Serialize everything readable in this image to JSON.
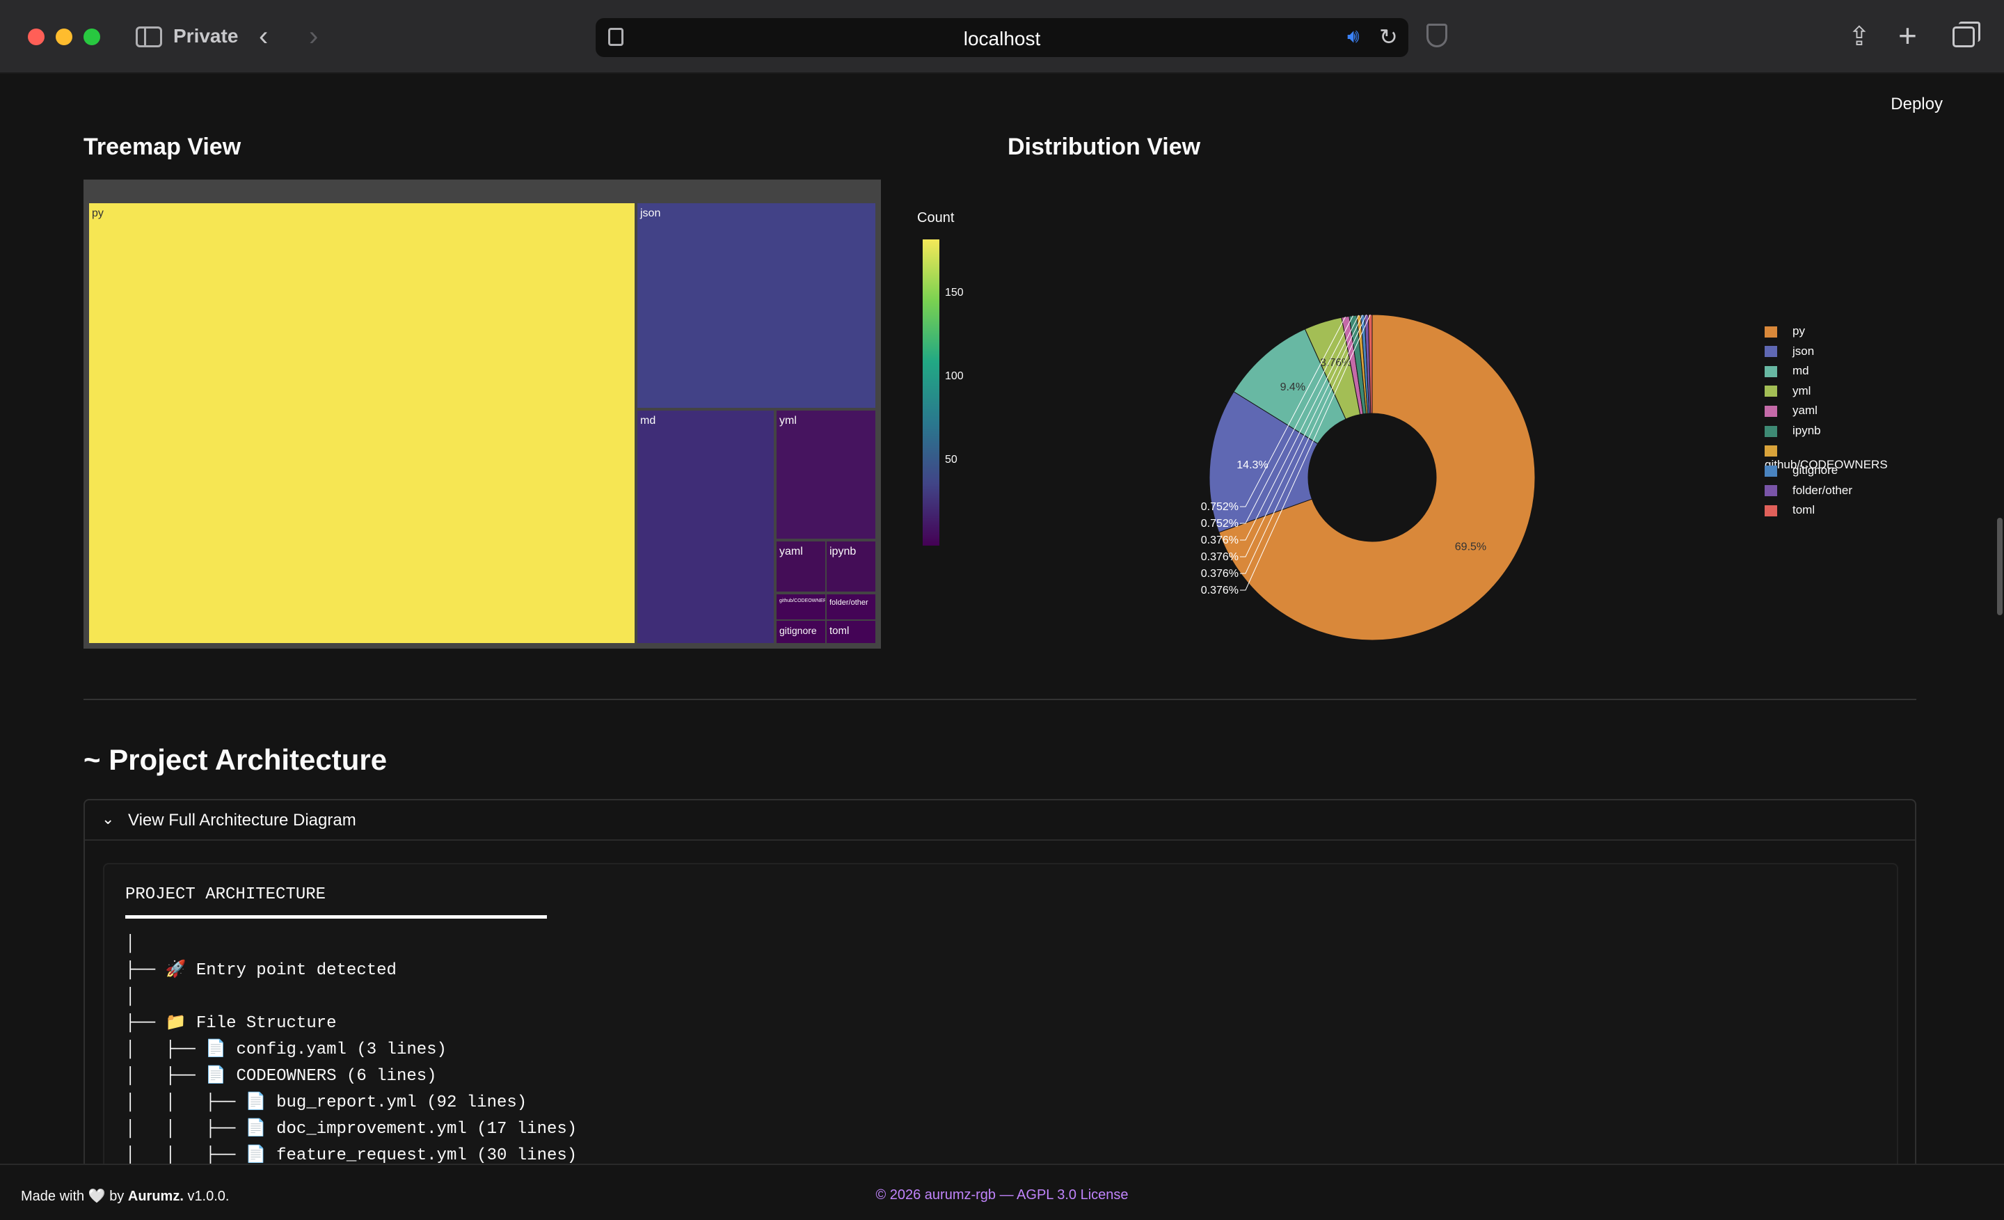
{
  "browser": {
    "window_label": "Private",
    "url": "localhost",
    "icons": [
      "sidebar-icon",
      "back-icon",
      "forward-icon",
      "page-icon",
      "sound-icon",
      "reload-icon",
      "shield-icon",
      "share-icon",
      "new-tab-icon",
      "tabs-icon"
    ]
  },
  "app": {
    "deploy_label": "Deploy",
    "treemap_title": "Treemap View",
    "distribution_title": "Distribution View",
    "architecture_title": "~ Project Architecture",
    "expander_label": "View Full Architecture Diagram"
  },
  "chart_data": [
    {
      "type": "treemap",
      "colorbar_title": "Count",
      "colorbar_ticks": [
        "150",
        "100",
        "50"
      ],
      "colorscale": [
        "#440154",
        "#414487",
        "#2a788e",
        "#22a884",
        "#7ad151",
        "#f4e859"
      ],
      "cells": [
        {
          "label": "py",
          "value": 185,
          "color": "#f6e653"
        },
        {
          "label": "json",
          "value": 38,
          "color": "#424287"
        },
        {
          "label": "md",
          "value": 25,
          "color": "#3f2d77"
        },
        {
          "label": "yml",
          "value": 10,
          "color": "#46145f"
        },
        {
          "label": "yaml",
          "value": 2,
          "color": "#440d57"
        },
        {
          "label": "ipynb",
          "value": 2,
          "color": "#440d57"
        },
        {
          "label": "github/CODEOWNERS",
          "value": 1,
          "color": "#440456"
        },
        {
          "label": "folder/other",
          "value": 1,
          "color": "#440456"
        },
        {
          "label": "gitignore",
          "value": 1,
          "color": "#440456"
        },
        {
          "label": "toml",
          "value": 1,
          "color": "#440456"
        }
      ]
    },
    {
      "type": "pie",
      "hole": true,
      "legend_position": "right",
      "slices": [
        {
          "label": "py",
          "percent": 69.5,
          "text": "69.5%",
          "color": "#d9883a"
        },
        {
          "label": "json",
          "percent": 14.3,
          "text": "14.3%",
          "color": "#5f68b3"
        },
        {
          "label": "md",
          "percent": 9.4,
          "text": "9.4%",
          "color": "#68b8a3"
        },
        {
          "label": "yml",
          "percent": 3.76,
          "text": "3.76%",
          "color": "#a3be55"
        },
        {
          "label": "yaml",
          "percent": 0.752,
          "text": "0.752%",
          "color": "#c46aa8"
        },
        {
          "label": "ipynb",
          "percent": 0.752,
          "text": "0.752%",
          "color": "#3e8a74"
        },
        {
          "label": "github/CODEOWNERS",
          "percent": 0.376,
          "text": "0.376%",
          "color": "#d9a33a"
        },
        {
          "label": "gitignore",
          "percent": 0.376,
          "text": "0.376%",
          "color": "#4a84c0"
        },
        {
          "label": "folder/other",
          "percent": 0.376,
          "text": "0.376%",
          "color": "#7a55a8"
        },
        {
          "label": "toml",
          "percent": 0.376,
          "text": "0.376%",
          "color": "#e0605a"
        }
      ]
    }
  ],
  "architecture": {
    "header": "PROJECT ARCHITECTURE",
    "lines": [
      "│",
      "├── 🚀 Entry point detected",
      "│",
      "├── 📁 File Structure",
      "│   ├── 📄 config.yaml (3 lines)",
      "│   ├── 📄 CODEOWNERS (6 lines)",
      "│   │   ├── 📄 bug_report.yml (92 lines)",
      "│   │   ├── 📄 doc_improvement.yml (17 lines)",
      "│   │   ├── 📄 feature_request.yml (30 lines)"
    ]
  },
  "footer": {
    "made_with_prefix": "Made with",
    "heart": "🤍",
    "by": "by",
    "brand": "Aurumz.",
    "version": "v1.0.0.",
    "copyright": "© 2026 aurumz-rgb — AGPL 3.0 License"
  }
}
